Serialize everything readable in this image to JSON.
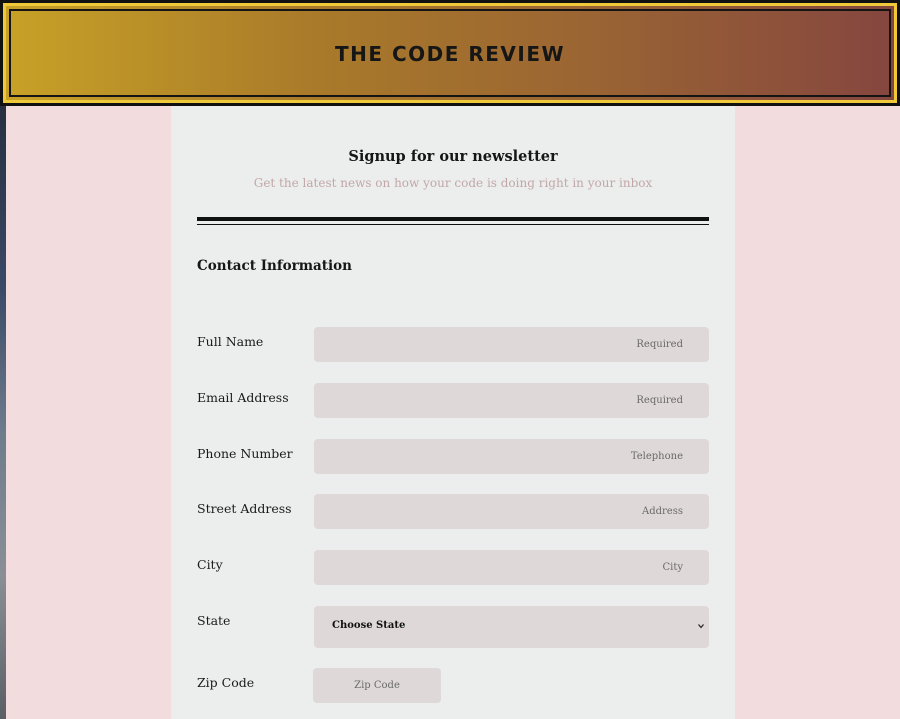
{
  "header": {
    "site_title": "THE CODE REVIEW"
  },
  "form": {
    "title": "Signup for our newsletter",
    "subtitle": "Get the latest news on how your code is doing right in your inbox",
    "section_title": "Contact Information",
    "fields": {
      "full_name": {
        "label": "Full Name",
        "placeholder": "Required"
      },
      "email": {
        "label": "Email Address",
        "placeholder": "Required"
      },
      "phone": {
        "label": "Phone Number",
        "placeholder": "Telephone"
      },
      "street": {
        "label": "Street Address",
        "placeholder": "Address"
      },
      "city": {
        "label": "City",
        "placeholder": "City"
      },
      "state": {
        "label": "State",
        "selected": "Choose State"
      },
      "zip": {
        "label": "Zip Code",
        "placeholder": "Zip Code"
      }
    }
  },
  "colors": {
    "page_background": "#f2dcde",
    "panel_background": "#eceeed",
    "input_background": "#ded8d8",
    "header_gold": "#c7a127",
    "header_maroon": "#85463f",
    "subtitle_text": "#c2a7a7"
  },
  "icons": {
    "state_dropdown": "chevron-down-icon"
  }
}
